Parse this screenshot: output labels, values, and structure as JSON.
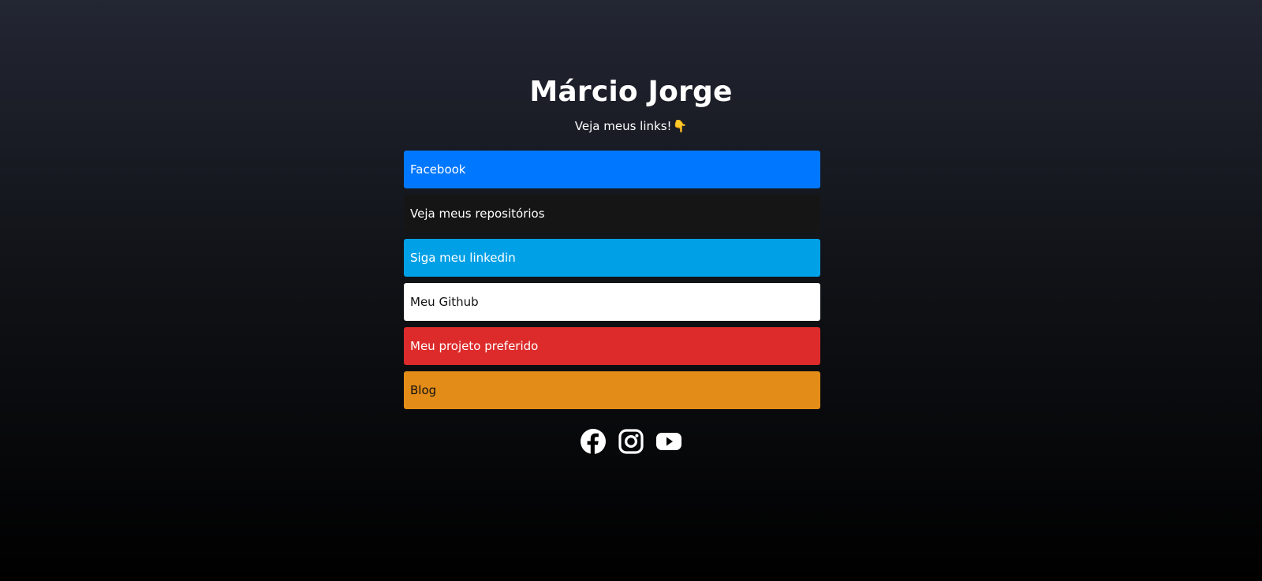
{
  "profile": {
    "name": "Márcio Jorge",
    "subtitle": "Veja meus links!",
    "subtitle_emoji": "👇"
  },
  "links": [
    {
      "label": "Facebook",
      "bg": "#0077FF",
      "fg": "#FFFFFF"
    },
    {
      "label": "Veja meus repositórios",
      "bg": "#151515",
      "fg": "#FFFFFF"
    },
    {
      "label": "Siga meu linkedin",
      "bg": "#00A0E6",
      "fg": "#FFFFFF"
    },
    {
      "label": "Meu Github",
      "bg": "#FFFFFF",
      "fg": "#111111"
    },
    {
      "label": "Meu projeto preferido",
      "bg": "#DD2B2B",
      "fg": "#FFFFFF"
    },
    {
      "label": "Blog",
      "bg": "#E38D18",
      "fg": "#111111"
    }
  ],
  "social_icons": [
    {
      "name": "facebook-icon"
    },
    {
      "name": "instagram-icon"
    },
    {
      "name": "youtube-icon"
    }
  ],
  "colors": {
    "background_top": "#232633",
    "background_bottom": "#000000",
    "text": "#FFFFFF"
  }
}
